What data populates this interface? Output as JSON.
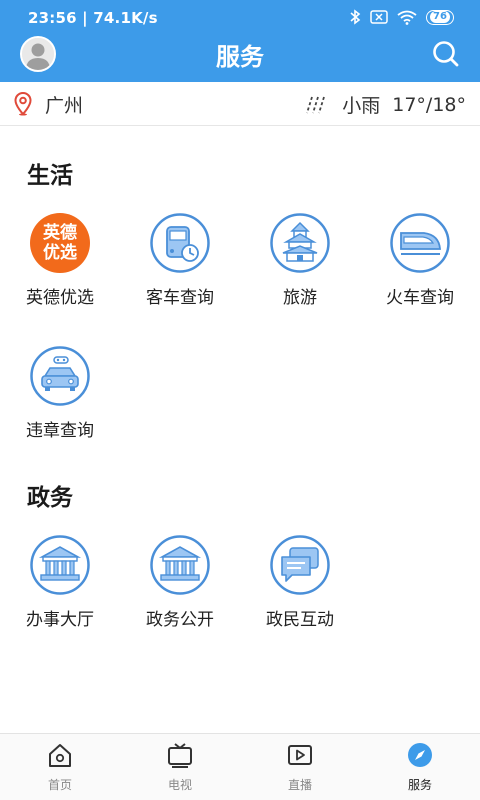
{
  "status_bar": {
    "time_speed": "23:56 | 74.1K/s",
    "battery": "76"
  },
  "header": {
    "title": "服务"
  },
  "location": {
    "city": "广州",
    "weather": "小雨",
    "temperature": "17°/18°"
  },
  "sections": {
    "life": {
      "title": "生活",
      "items": [
        {
          "label": "英德优选",
          "icon": "yingde-youxuan-logo",
          "logo_line1": "英德",
          "logo_line2": "优选"
        },
        {
          "label": "客车查询",
          "icon": "bus-clock-icon"
        },
        {
          "label": "旅游",
          "icon": "temple-icon"
        },
        {
          "label": "火车查询",
          "icon": "bullet-train-icon"
        },
        {
          "label": "违章查询",
          "icon": "traffic-car-icon"
        }
      ]
    },
    "gov": {
      "title": "政务",
      "items": [
        {
          "label": "办事大厅",
          "icon": "government-building-icon"
        },
        {
          "label": "政务公开",
          "icon": "government-building-icon"
        },
        {
          "label": "政民互动",
          "icon": "chat-bubbles-icon"
        }
      ]
    }
  },
  "bottom_nav": [
    {
      "label": "首页",
      "icon": "home-icon",
      "active": false
    },
    {
      "label": "电视",
      "icon": "tv-icon",
      "active": false
    },
    {
      "label": "直播",
      "icon": "live-video-icon",
      "active": false
    },
    {
      "label": "服务",
      "icon": "compass-icon",
      "active": true
    }
  ],
  "colors": {
    "header_blue": "#3d9be9",
    "icon_ring": "#4a8fd8",
    "icon_fill": "#9cc6f3",
    "brand_orange": "#f26a1b",
    "pin_red": "#e04a3a"
  }
}
